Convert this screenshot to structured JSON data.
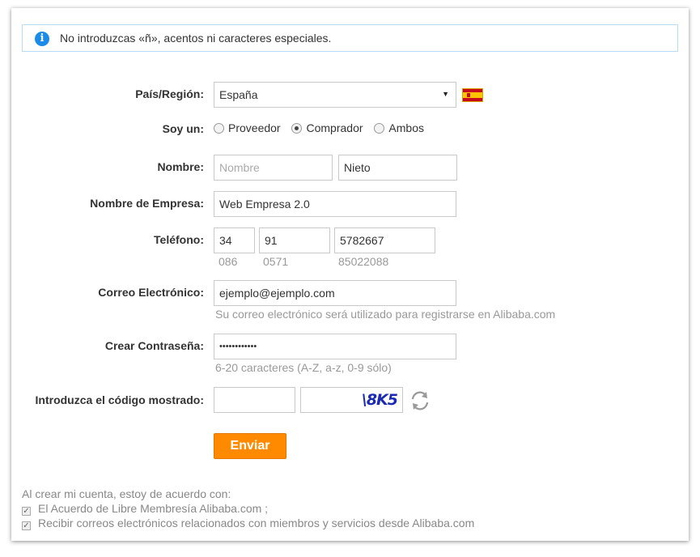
{
  "info": {
    "message": "No introduzcas «ñ», acentos ni caracteres especiales."
  },
  "country": {
    "label": "País/Región:",
    "value": "España"
  },
  "role": {
    "label": "Soy un:",
    "options": [
      "Proveedor",
      "Comprador",
      "Ambos"
    ],
    "selected": "Comprador"
  },
  "name": {
    "label": "Nombre:",
    "first_placeholder": "Nombre",
    "last_value": "Nieto"
  },
  "company": {
    "label": "Nombre de Empresa:",
    "value": "Web Empresa 2.0"
  },
  "phone": {
    "label": "Teléfono:",
    "country_code": "34",
    "area_code": "91",
    "number": "5782667",
    "country_hint": "086",
    "area_hint": "0571",
    "number_hint": "85022088"
  },
  "email": {
    "label": "Correo Electrónico:",
    "value": "ejemplo@ejemplo.com",
    "hint": "Su correo electrónico será utilizado para registrarse en Alibaba.com"
  },
  "password": {
    "label": "Crear Contraseña:",
    "value": "••••••••••••",
    "hint": "6-20 caracteres (A-Z, a-z, 0-9 sólo)"
  },
  "captcha": {
    "label": "Introduzca el código mostrado:",
    "code": "\\8K5"
  },
  "submit": {
    "label": "Enviar"
  },
  "terms": {
    "intro": "Al crear mi cuenta, estoy de acuerdo con:",
    "items": [
      "El Acuerdo de Libre Membresía Alibaba.com ;",
      "Recibir correos electrónicos relacionados con miembros y servicios desde Alibaba.com"
    ]
  },
  "colors": {
    "accent": "#ff8a00",
    "info_border": "#b9dcf3",
    "info_icon": "#1a8be8"
  },
  "icons": {
    "info": "info-icon",
    "flag": "spain-flag-icon",
    "refresh": "refresh-icon",
    "dropdown": "chevron-down-icon"
  }
}
